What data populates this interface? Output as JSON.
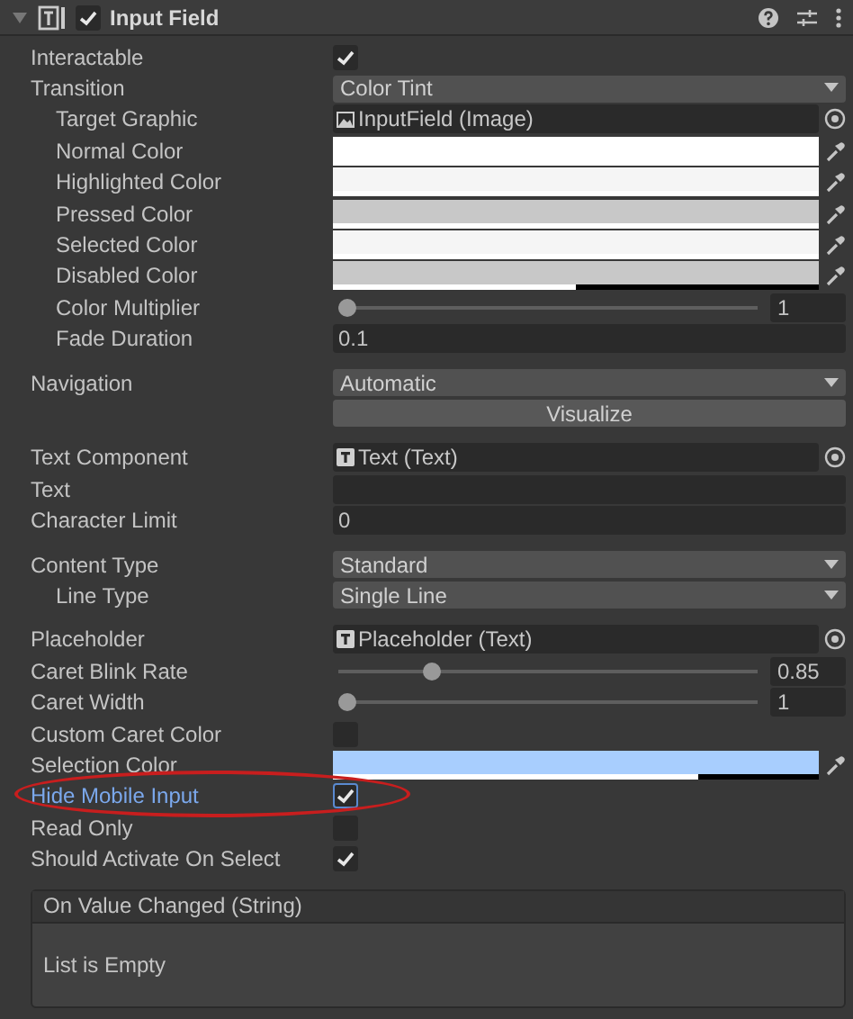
{
  "component": {
    "title": "Input Field",
    "enabled": true,
    "expanded": true
  },
  "rows": [
    {
      "label": "Interactable",
      "kind": "checkbox",
      "checked": true
    },
    {
      "label": "Transition",
      "kind": "dropdown",
      "value": "Color Tint",
      "children": [
        {
          "label": "Target Graphic",
          "kind": "image_ref",
          "value": "InputField (Image)"
        },
        {
          "label": "Normal Color",
          "kind": "color",
          "color": "#ffffff",
          "level": 1
        },
        {
          "label": "Highlighted Color",
          "kind": "color",
          "color": "#f5f5f5",
          "level": 1
        },
        {
          "label": "Pressed Color",
          "kind": "color",
          "color": "#c8c8c8",
          "level": 1
        },
        {
          "label": "Selected Color",
          "kind": "color",
          "color": "#f5f5f5",
          "level": 1
        },
        {
          "label": "Disabled Color",
          "kind": "color",
          "color": "#c8c8c8",
          "level": 0.5
        },
        {
          "label": "Color Multiplier",
          "kind": "slider",
          "level": 0,
          "value": "1"
        },
        {
          "label": "Fade Duration",
          "kind": "field",
          "value": "0.1"
        }
      ]
    },
    {
      "label": "Navigation",
      "kind": "dropdown",
      "value": "Automatic",
      "gap_before": true
    },
    {
      "kind": "button",
      "value": "Visualize"
    },
    {
      "label": "Text Component",
      "kind": "text_ref",
      "value": "Text (Text)",
      "gap_before": true
    },
    {
      "label": "Text",
      "kind": "field"
    },
    {
      "label": "Character Limit",
      "kind": "field",
      "value": "0"
    },
    {
      "label": "Content Type",
      "kind": "dropdown",
      "value": "Standard",
      "gap_before": true,
      "children": [
        {
          "label": "Line Type",
          "kind": "dropdown",
          "value": "Single Line"
        }
      ]
    },
    {
      "label": "Placeholder",
      "kind": "text_ref",
      "value": "Placeholder (Text)",
      "gap_before": true
    },
    {
      "label": "Caret Blink Rate",
      "kind": "slider",
      "level": 0.21,
      "value": "0.85"
    },
    {
      "label": "Caret Width",
      "kind": "slider",
      "level": 0,
      "value": "1"
    },
    {
      "label": "Custom Caret Color",
      "kind": "checkbox",
      "checked": false
    },
    {
      "label": "Selection Color",
      "kind": "color",
      "color": "#a8cefe",
      "level": 0.75
    },
    {
      "label": "Hide Mobile Input",
      "kind": "checkbox",
      "checked": true,
      "highlighted": true
    },
    {
      "label": "Read Only",
      "kind": "checkbox",
      "checked": false
    },
    {
      "label": "Should Activate On Select",
      "kind": "checkbox",
      "checked": true
    }
  ],
  "event": {
    "title": "On Value Changed (String)",
    "message": "List is Empty"
  }
}
